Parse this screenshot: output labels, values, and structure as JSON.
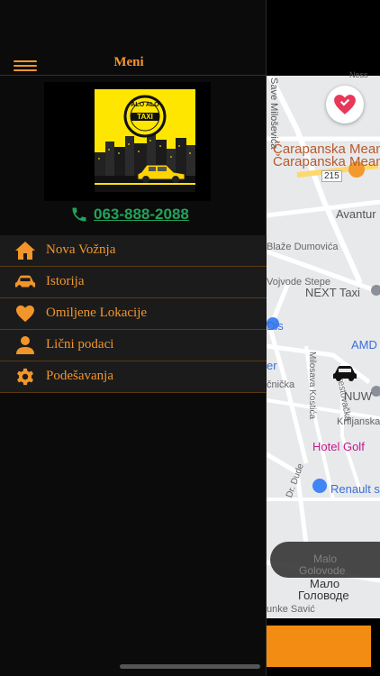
{
  "drawer": {
    "title": "Meni",
    "phone": "063-888-2088",
    "logo": {
      "ring_top": "ALO ALO",
      "ring_center": "TAXI"
    },
    "items": [
      {
        "label": "Nova Vožnja",
        "icon": "home-icon"
      },
      {
        "label": "Istorija",
        "icon": "car-icon"
      },
      {
        "label": "Omiljene Lokacije",
        "icon": "heart-icon"
      },
      {
        "label": "Lični podaci",
        "icon": "user-icon"
      },
      {
        "label": "Podešavanja",
        "icon": "gear-icon"
      }
    ]
  },
  "map": {
    "labels": {
      "sava": "Save Miloševića",
      "caripanska1": "Čarapanska Meana",
      "caripanska2": "Čarapanska Meana",
      "road215": "215",
      "avantura": "Avantur",
      "dumovica": "Blaže Dumovića",
      "stepe": "Vojvode Stepe",
      "nexttaxi": "NEXT Taxi",
      "dis": "Dis",
      "amd": "AMD",
      "kostica": "Milosava Kostića",
      "brestovacka": "Brestovačka",
      "er": "er",
      "micka": "čnička",
      "nuw": "NUW",
      "krfljanska": "Krfljanska",
      "hotelgolf": "Hotel Golf",
      "dude": "Dr. Dude",
      "renault": "Renault s",
      "malo_lat": "Malo",
      "golovode_lat": "Golovode",
      "malo_cyr": "Мало",
      "golovode_cyr": "Головоде",
      "savic": "unke Savić",
      "ness": "Ness"
    },
    "colors": {
      "accent": "#f2962b",
      "phone": "#21a35a",
      "favorite": "#e8385a"
    }
  }
}
